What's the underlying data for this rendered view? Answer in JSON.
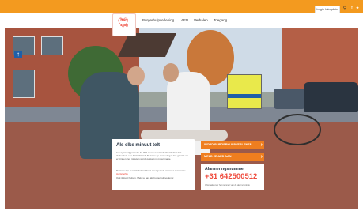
{
  "topbar": {
    "login_label": "Login Inlogdata",
    "icons": [
      "search-icon",
      "facebook-icon",
      "twitter-icon",
      "instagram-icon",
      "linkedin-icon"
    ],
    "accent": "#f39a1f"
  },
  "logo": {
    "line1": "hart",
    "line2": "slag"
  },
  "nav": {
    "items": [
      "Burgerhulpverlening",
      "AED",
      "Verhalen",
      "Toegang"
    ]
  },
  "card": {
    "title": "Als elke minuut telt",
    "text1": "Ieder jaar krijgen ruim 16.000 mensen in Nederland buiten het ziekenhuis een hartstilstand. De kans op overleving is het grootst als er binnen zes minuten wordt gestart met reanimatie.",
    "text2_prefix": "Daarom zijn er in Nederland heel opengesteld en meer reanimatie-",
    "text2_link": "HartslagNu",
    "text3": "Ook jij kunt helpen. Meld je aan als burgerhulpverlener."
  },
  "buttons": {
    "primary": "WORD BURGERHULPVERLENER",
    "secondary": "MELD JE AED AAN"
  },
  "alarm": {
    "label": "Alarmeringsnummer",
    "number": "+31 642500512",
    "note": "Informatie over het nummer van de alarmcentrale"
  },
  "colors": {
    "brand": "#ef4a3c",
    "orange": "#ef7e1f"
  }
}
